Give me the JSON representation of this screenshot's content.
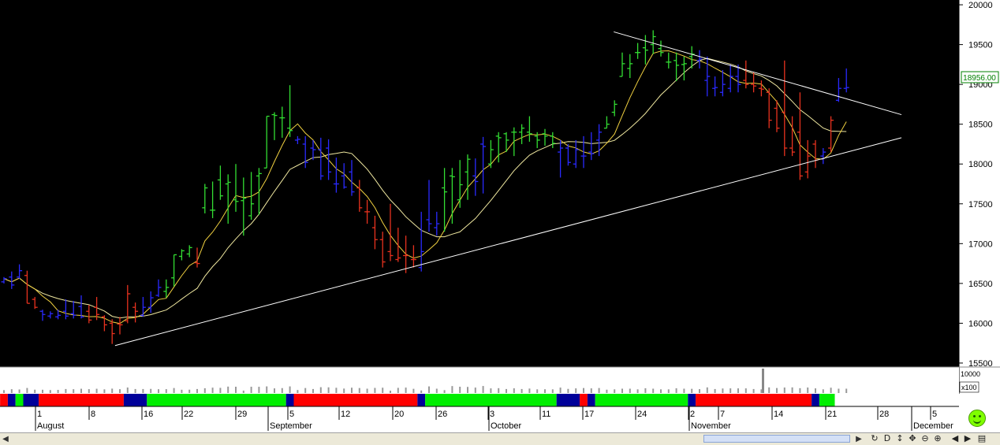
{
  "chart_data": {
    "type": "ohlc",
    "y_axis_ticks": [
      "20000",
      "19500",
      "19000",
      "18500",
      "18000",
      "17500",
      "17000",
      "16500",
      "16000",
      "15500"
    ],
    "ylim": [
      15450,
      20060
    ],
    "last_price_label": "18956.00",
    "volume_unit_label": "x100",
    "volume_overlap_label": "10000",
    "date_ticks": [
      "1",
      "8",
      "16",
      "22",
      "29",
      "5",
      "12",
      "20",
      "26",
      "3",
      "11",
      "17",
      "24",
      "2",
      "7",
      "14",
      "21",
      "28",
      "5"
    ],
    "month_labels": [
      "August",
      "September",
      "October",
      "November",
      "December"
    ],
    "bars": [
      {
        "o": 16520,
        "h": 16580,
        "l": 16500,
        "c": 16560,
        "color": "blue"
      },
      {
        "o": 16580,
        "h": 16650,
        "l": 16430,
        "c": 16480,
        "color": "blue"
      },
      {
        "o": 16580,
        "h": 16740,
        "l": 16560,
        "c": 16660,
        "color": "blue"
      },
      {
        "o": 16600,
        "h": 16660,
        "l": 16250,
        "c": 16250,
        "color": "red"
      },
      {
        "o": 16300,
        "h": 16330,
        "l": 16180,
        "c": 16200,
        "color": "red"
      },
      {
        "o": 16150,
        "h": 16170,
        "l": 16030,
        "c": 16110,
        "color": "blue"
      },
      {
        "o": 16090,
        "h": 16150,
        "l": 16060,
        "c": 16120,
        "color": "blue"
      },
      {
        "o": 16080,
        "h": 16170,
        "l": 16050,
        "c": 16100,
        "color": "blue"
      },
      {
        "o": 16150,
        "h": 16300,
        "l": 16050,
        "c": 16090,
        "color": "blue"
      },
      {
        "o": 16120,
        "h": 16280,
        "l": 16060,
        "c": 16100,
        "color": "blue"
      },
      {
        "o": 16210,
        "h": 16350,
        "l": 16060,
        "c": 16080,
        "color": "blue"
      },
      {
        "o": 16150,
        "h": 16230,
        "l": 16000,
        "c": 16040,
        "color": "red"
      },
      {
        "o": 16200,
        "h": 16330,
        "l": 16040,
        "c": 16110,
        "color": "red"
      },
      {
        "o": 16080,
        "h": 16100,
        "l": 15900,
        "c": 15980,
        "color": "red"
      },
      {
        "o": 16000,
        "h": 16050,
        "l": 15740,
        "c": 15870,
        "color": "red"
      },
      {
        "o": 15990,
        "h": 16080,
        "l": 15860,
        "c": 15980,
        "color": "red"
      },
      {
        "o": 16030,
        "h": 16480,
        "l": 16000,
        "c": 16370,
        "color": "red"
      },
      {
        "o": 16200,
        "h": 16260,
        "l": 16010,
        "c": 16150,
        "color": "red"
      },
      {
        "o": 16100,
        "h": 16330,
        "l": 16080,
        "c": 16200,
        "color": "blue"
      },
      {
        "o": 16200,
        "h": 16400,
        "l": 16130,
        "c": 16320,
        "color": "blue"
      },
      {
        "o": 16350,
        "h": 16550,
        "l": 16330,
        "c": 16450,
        "color": "blue"
      },
      {
        "o": 16400,
        "h": 16550,
        "l": 16320,
        "c": 16450,
        "color": "green"
      },
      {
        "o": 16570,
        "h": 16860,
        "l": 16460,
        "c": 16860,
        "color": "green"
      },
      {
        "o": 16840,
        "h": 16930,
        "l": 16790,
        "c": 16910,
        "color": "green"
      },
      {
        "o": 16870,
        "h": 16980,
        "l": 16830,
        "c": 16950,
        "color": "green"
      },
      {
        "o": 16760,
        "h": 16950,
        "l": 16700,
        "c": 16750,
        "color": "red"
      },
      {
        "o": 17450,
        "h": 17750,
        "l": 17380,
        "c": 17700,
        "color": "green"
      },
      {
        "o": 17420,
        "h": 17780,
        "l": 17320,
        "c": 17420,
        "color": "green"
      },
      {
        "o": 17800,
        "h": 17980,
        "l": 17550,
        "c": 17600,
        "color": "green"
      },
      {
        "o": 17750,
        "h": 17870,
        "l": 17250,
        "c": 17770,
        "color": "green"
      },
      {
        "o": 17550,
        "h": 18000,
        "l": 17400,
        "c": 17530,
        "color": "green"
      },
      {
        "o": 17540,
        "h": 17830,
        "l": 17100,
        "c": 17570,
        "color": "green"
      },
      {
        "o": 17350,
        "h": 17900,
        "l": 17300,
        "c": 17500,
        "color": "green"
      },
      {
        "o": 17850,
        "h": 17950,
        "l": 17360,
        "c": 17880,
        "color": "green"
      },
      {
        "o": 17950,
        "h": 18600,
        "l": 17950,
        "c": 18600,
        "color": "green"
      },
      {
        "o": 18620,
        "h": 18650,
        "l": 18300,
        "c": 18610,
        "color": "green"
      },
      {
        "o": 18580,
        "h": 18720,
        "l": 18330,
        "c": 18580,
        "color": "green"
      },
      {
        "o": 18450,
        "h": 18990,
        "l": 18340,
        "c": 18420,
        "color": "green"
      },
      {
        "o": 18300,
        "h": 18350,
        "l": 18250,
        "c": 18310,
        "color": "blue"
      },
      {
        "o": 18250,
        "h": 18350,
        "l": 17950,
        "c": 18020,
        "color": "blue"
      },
      {
        "o": 18200,
        "h": 18300,
        "l": 18050,
        "c": 18180,
        "color": "blue"
      },
      {
        "o": 18180,
        "h": 18330,
        "l": 17800,
        "c": 17850,
        "color": "blue"
      },
      {
        "o": 18200,
        "h": 18310,
        "l": 17800,
        "c": 17900,
        "color": "blue"
      },
      {
        "o": 17750,
        "h": 18080,
        "l": 17640,
        "c": 17750,
        "color": "blue"
      },
      {
        "o": 17850,
        "h": 18010,
        "l": 17690,
        "c": 17710,
        "color": "blue"
      },
      {
        "o": 17900,
        "h": 18050,
        "l": 17600,
        "c": 17650,
        "color": "blue"
      },
      {
        "o": 17700,
        "h": 17800,
        "l": 17400,
        "c": 17450,
        "color": "red"
      },
      {
        "o": 17400,
        "h": 17550,
        "l": 17250,
        "c": 17400,
        "color": "red"
      },
      {
        "o": 17200,
        "h": 17350,
        "l": 16930,
        "c": 17050,
        "color": "red"
      },
      {
        "o": 17050,
        "h": 17150,
        "l": 16700,
        "c": 16770,
        "color": "red"
      },
      {
        "o": 16900,
        "h": 17500,
        "l": 16780,
        "c": 16850,
        "color": "red"
      },
      {
        "o": 16800,
        "h": 17200,
        "l": 16770,
        "c": 16820,
        "color": "red"
      },
      {
        "o": 16850,
        "h": 17100,
        "l": 16630,
        "c": 16850,
        "color": "red"
      },
      {
        "o": 16800,
        "h": 16980,
        "l": 16700,
        "c": 16800,
        "color": "red"
      },
      {
        "o": 16700,
        "h": 17400,
        "l": 16650,
        "c": 16900,
        "color": "blue"
      },
      {
        "o": 17300,
        "h": 17800,
        "l": 17150,
        "c": 17250,
        "color": "blue"
      },
      {
        "o": 17200,
        "h": 17400,
        "l": 17100,
        "c": 17250,
        "color": "blue"
      },
      {
        "o": 17700,
        "h": 17950,
        "l": 17150,
        "c": 17650,
        "color": "green"
      },
      {
        "o": 17850,
        "h": 17950,
        "l": 17250,
        "c": 17840,
        "color": "green"
      },
      {
        "o": 17550,
        "h": 18050,
        "l": 17450,
        "c": 17740,
        "color": "green"
      },
      {
        "o": 17900,
        "h": 18120,
        "l": 17550,
        "c": 18060,
        "color": "green"
      },
      {
        "o": 17850,
        "h": 18070,
        "l": 17600,
        "c": 17780,
        "color": "blue"
      },
      {
        "o": 18250,
        "h": 18340,
        "l": 17630,
        "c": 18220,
        "color": "blue"
      },
      {
        "o": 18000,
        "h": 18300,
        "l": 17950,
        "c": 18180,
        "color": "green"
      },
      {
        "o": 18350,
        "h": 18400,
        "l": 18020,
        "c": 18330,
        "color": "green"
      },
      {
        "o": 18380,
        "h": 18400,
        "l": 18150,
        "c": 18300,
        "color": "green"
      },
      {
        "o": 18400,
        "h": 18460,
        "l": 18100,
        "c": 18400,
        "color": "green"
      },
      {
        "o": 18400,
        "h": 18500,
        "l": 18250,
        "c": 18450,
        "color": "green"
      },
      {
        "o": 18400,
        "h": 18600,
        "l": 18280,
        "c": 18380,
        "color": "green"
      },
      {
        "o": 18350,
        "h": 18400,
        "l": 18200,
        "c": 18300,
        "color": "green"
      },
      {
        "o": 18380,
        "h": 18440,
        "l": 18230,
        "c": 18350,
        "color": "green"
      },
      {
        "o": 18350,
        "h": 18400,
        "l": 18200,
        "c": 18260,
        "color": "green"
      },
      {
        "o": 18150,
        "h": 18300,
        "l": 17830,
        "c": 18200,
        "color": "blue"
      },
      {
        "o": 18200,
        "h": 18250,
        "l": 17980,
        "c": 18020,
        "color": "blue"
      },
      {
        "o": 18000,
        "h": 18300,
        "l": 17950,
        "c": 18180,
        "color": "blue"
      },
      {
        "o": 18100,
        "h": 18350,
        "l": 17950,
        "c": 18100,
        "color": "blue"
      },
      {
        "o": 18150,
        "h": 18400,
        "l": 18050,
        "c": 18130,
        "color": "blue"
      },
      {
        "o": 18300,
        "h": 18500,
        "l": 18100,
        "c": 18400,
        "color": "blue"
      },
      {
        "o": 18450,
        "h": 18600,
        "l": 18450,
        "c": 18500,
        "color": "green"
      },
      {
        "o": 18650,
        "h": 18800,
        "l": 18600,
        "c": 18750,
        "color": "green"
      },
      {
        "o": 19100,
        "h": 19400,
        "l": 19100,
        "c": 19260,
        "color": "green"
      },
      {
        "o": 19200,
        "h": 19380,
        "l": 19080,
        "c": 19260,
        "color": "green"
      },
      {
        "o": 19400,
        "h": 19520,
        "l": 19320,
        "c": 19400,
        "color": "green"
      },
      {
        "o": 19460,
        "h": 19620,
        "l": 19250,
        "c": 19430,
        "color": "green"
      },
      {
        "o": 19500,
        "h": 19680,
        "l": 19380,
        "c": 19600,
        "color": "green"
      },
      {
        "o": 19450,
        "h": 19550,
        "l": 19350,
        "c": 19400,
        "color": "green"
      },
      {
        "o": 19280,
        "h": 19400,
        "l": 19200,
        "c": 19280,
        "color": "green"
      },
      {
        "o": 19300,
        "h": 19400,
        "l": 19040,
        "c": 19240,
        "color": "green"
      },
      {
        "o": 19250,
        "h": 19350,
        "l": 19050,
        "c": 19260,
        "color": "green"
      },
      {
        "o": 19350,
        "h": 19480,
        "l": 19200,
        "c": 19380,
        "color": "green"
      },
      {
        "o": 19300,
        "h": 19430,
        "l": 19200,
        "c": 19320,
        "color": "blue"
      },
      {
        "o": 19050,
        "h": 19350,
        "l": 18850,
        "c": 19100,
        "color": "blue"
      },
      {
        "o": 18950,
        "h": 19100,
        "l": 18850,
        "c": 18960,
        "color": "blue"
      },
      {
        "o": 18900,
        "h": 19180,
        "l": 18850,
        "c": 19000,
        "color": "blue"
      },
      {
        "o": 18950,
        "h": 19250,
        "l": 18900,
        "c": 19100,
        "color": "blue"
      },
      {
        "o": 19100,
        "h": 19250,
        "l": 18900,
        "c": 19000,
        "color": "blue"
      },
      {
        "o": 19050,
        "h": 19300,
        "l": 18950,
        "c": 19000,
        "color": "red"
      },
      {
        "o": 19000,
        "h": 19150,
        "l": 18900,
        "c": 18980,
        "color": "red"
      },
      {
        "o": 18950,
        "h": 19050,
        "l": 18850,
        "c": 18940,
        "color": "red"
      },
      {
        "o": 18900,
        "h": 18950,
        "l": 18450,
        "c": 18550,
        "color": "red"
      },
      {
        "o": 18700,
        "h": 18800,
        "l": 18400,
        "c": 18450,
        "color": "red"
      },
      {
        "o": 18650,
        "h": 19300,
        "l": 18100,
        "c": 18200,
        "color": "red"
      },
      {
        "o": 18200,
        "h": 18600,
        "l": 18100,
        "c": 18150,
        "color": "red"
      },
      {
        "o": 18400,
        "h": 18900,
        "l": 17800,
        "c": 17850,
        "color": "red"
      },
      {
        "o": 17900,
        "h": 18300,
        "l": 17820,
        "c": 18100,
        "color": "red"
      },
      {
        "o": 18250,
        "h": 18300,
        "l": 17950,
        "c": 18050,
        "color": "red"
      },
      {
        "o": 18100,
        "h": 18200,
        "l": 18000,
        "c": 18150,
        "color": "blue"
      },
      {
        "o": 18200,
        "h": 18600,
        "l": 18150,
        "c": 18550,
        "color": "red"
      },
      {
        "o": 18800,
        "h": 19080,
        "l": 18780,
        "c": 18950,
        "color": "blue"
      },
      {
        "o": 18950,
        "h": 19200,
        "l": 18900,
        "c": 18960,
        "color": "blue"
      }
    ],
    "trend_lines": [
      {
        "x1": 0.12,
        "y1": 15720,
        "x2": 0.94,
        "y2": 18330
      },
      {
        "x1": 0.64,
        "y1": 19660,
        "x2": 0.94,
        "y2": 18620
      }
    ],
    "band_segments": [
      {
        "from": 0,
        "to": 1,
        "color": "red"
      },
      {
        "from": 1,
        "to": 2,
        "color": "blue"
      },
      {
        "from": 2,
        "to": 3,
        "color": "green"
      },
      {
        "from": 3,
        "to": 5,
        "color": "blue"
      },
      {
        "from": 5,
        "to": 16,
        "color": "red"
      },
      {
        "from": 16,
        "to": 19,
        "color": "blue"
      },
      {
        "from": 19,
        "to": 37,
        "color": "green"
      },
      {
        "from": 37,
        "to": 38,
        "color": "blue"
      },
      {
        "from": 38,
        "to": 54,
        "color": "red"
      },
      {
        "from": 54,
        "to": 55,
        "color": "blue"
      },
      {
        "from": 55,
        "to": 72,
        "color": "green"
      },
      {
        "from": 72,
        "to": 75,
        "color": "blue"
      },
      {
        "from": 75,
        "to": 76,
        "color": "red"
      },
      {
        "from": 76,
        "to": 77,
        "color": "blue"
      },
      {
        "from": 77,
        "to": 89,
        "color": "green"
      },
      {
        "from": 89,
        "to": 90,
        "color": "blue"
      },
      {
        "from": 90,
        "to": 105,
        "color": "red"
      },
      {
        "from": 105,
        "to": 106,
        "color": "blue"
      },
      {
        "from": 106,
        "to": 108,
        "color": "green"
      }
    ],
    "colors": {
      "background": "#000000",
      "green": "#33dd33",
      "red": "#e8321e",
      "blue": "#2a2aff",
      "ma_fast": "#f0d040",
      "ma_slow": "#f0e8a0",
      "trend": "#ffffff",
      "band_green": "#00ee00",
      "band_red": "#ff0000",
      "band_blue": "#000099"
    }
  },
  "toolbar": {
    "icons": [
      "refresh-icon",
      "d-icon",
      "up-down-icon",
      "move-icon",
      "zoom-out-icon",
      "zoom-in-icon",
      "prev-icon",
      "next-icon",
      "window-icon"
    ]
  }
}
